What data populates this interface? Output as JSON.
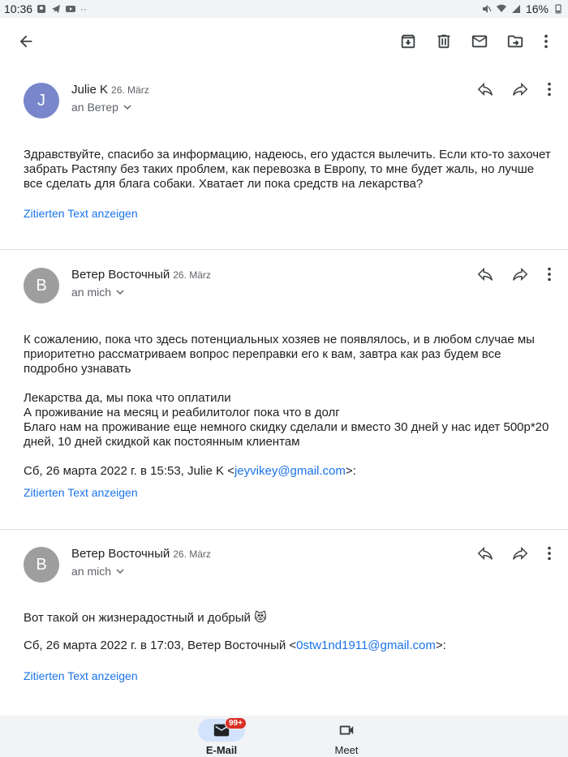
{
  "status_bar": {
    "time": "10:36",
    "battery": "16%"
  },
  "colors": {
    "accent": "#1a73e8",
    "avatar_julie": "#7986cb",
    "avatar_veter": "#9e9e9e",
    "nav_active_pill": "#d3e3fd",
    "badge": "#d93025"
  },
  "toolbar": {
    "back_icon": "arrow-back-icon",
    "actions": [
      "archive-icon",
      "delete-icon",
      "mark-unread-icon",
      "move-to-icon",
      "more-vert-icon"
    ]
  },
  "messages": [
    {
      "avatar_letter": "J",
      "sender": "Julie K",
      "date": "26. März",
      "recipient": "an Ветер",
      "body": [
        "Здравствуйте,  спасибо за информацию, надеюсь, его удастся вылечить. Если кто-то захочет забрать Растяпу без таких проблем, как перевозка в Европу, то мне будет жаль, но лучше все сделать для блага собаки. Хватает ли пока средств на лекарства?"
      ],
      "quoted_link": "Zitierten Text anzeigen"
    },
    {
      "avatar_letter": "B",
      "sender": "Ветер Восточный",
      "date": "26. März",
      "recipient": "an mich",
      "body": [
        "К сожалению, пока что здесь потенциальных хозяев не появлялось, и в любом случае мы приоритетно рассматриваем вопрос переправки его к вам, завтра как раз будем все подробно узнавать",
        "Лекарства да, мы пока что оплатили",
        "А проживание на месяц и реабилитолог пока что в долг",
        "Благо нам на проживание еще немного скидку сделали и вместо 30 дней у нас идет 500р*20 дней, 10 дней скидкой как постоянным клиентам"
      ],
      "quote_header_prefix": "Сб, 26 марта 2022 г. в 15:53, Julie K <",
      "quote_header_email": "jeyvikey@gmail.com",
      "quote_header_suffix": ">:",
      "quoted_link": "Zitierten Text anzeigen"
    },
    {
      "avatar_letter": "B",
      "sender": "Ветер Восточный",
      "date": "26. März",
      "recipient": "an mich",
      "body": [
        "Вот такой он жизнерадостный и добрый 😻"
      ],
      "quote_header_prefix": "Сб, 26 марта 2022 г. в 17:03, Ветер Восточный <",
      "quote_header_email": "0stw1nd1911@gmail.com",
      "quote_header_suffix": ">:",
      "quoted_link": "Zitierten Text anzeigen"
    }
  ],
  "bottom_nav": {
    "mail_label": "E-Mail",
    "mail_badge": "99+",
    "meet_label": "Meet"
  }
}
